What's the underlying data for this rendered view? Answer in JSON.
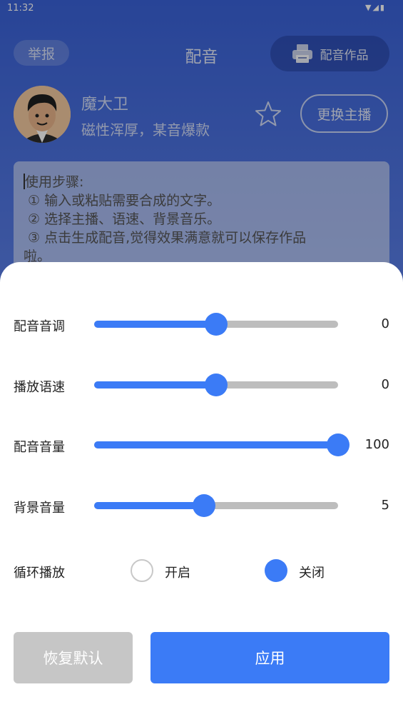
{
  "status": {
    "time": "11:32",
    "icons": "▼◢▮"
  },
  "header": {
    "report_label": "举报",
    "title": "配音",
    "works_label": "配音作品",
    "works_icon": "printer-icon"
  },
  "anchor": {
    "name": "魔大卫",
    "description": "磁性浑厚，某音爆款",
    "favorite_icon": "star-icon",
    "change_label": "更换主播"
  },
  "text_input": {
    "lines": [
      "使用步骤:",
      " ① 输入或粘贴需要合成的文字。",
      " ② 选择主播、语速、背景音乐。",
      " ③ 点击生成配音,觉得效果满意就可以保存作品",
      "啦。"
    ]
  },
  "settings": {
    "pitch": {
      "label": "配音音调",
      "value": "0",
      "level": 0.5
    },
    "speed": {
      "label": "播放语速",
      "value": "0",
      "level": 0.5
    },
    "volume": {
      "label": "配音音量",
      "value": "100",
      "level": 1.0
    },
    "bg_volume": {
      "label": "背景音量",
      "value": "5",
      "level": 0.45
    },
    "loop": {
      "label": "循环播放",
      "on_label": "开启",
      "off_label": "关闭",
      "selected": "off"
    }
  },
  "actions": {
    "reset_label": "恢复默认",
    "apply_label": "应用"
  },
  "colors": {
    "accent": "#3b7bf6",
    "disabled": "#c6c6c6"
  }
}
